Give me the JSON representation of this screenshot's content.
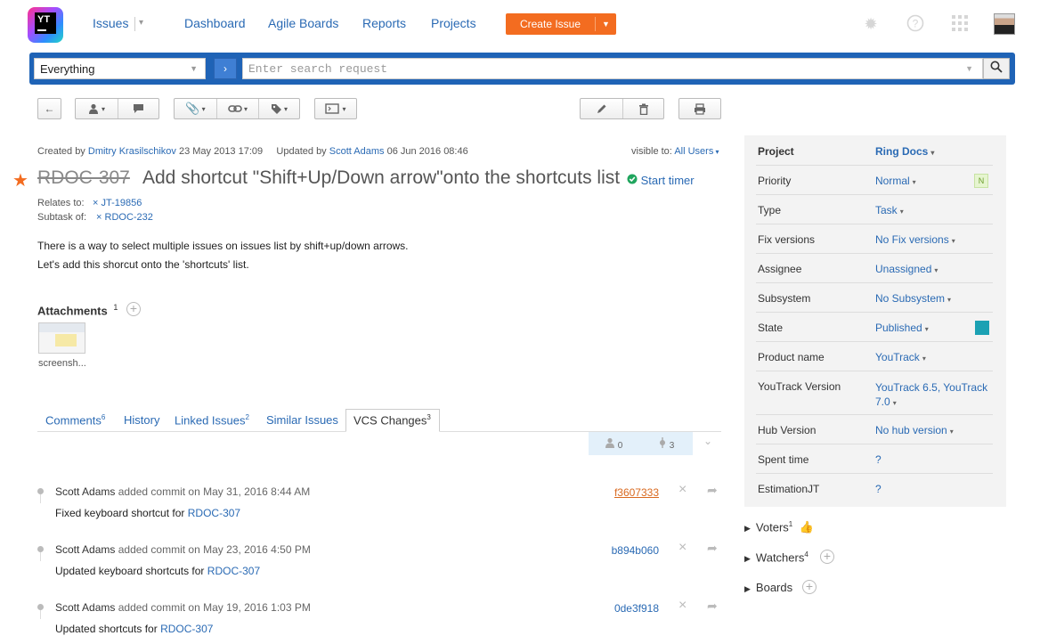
{
  "app": {
    "logo_text": "YT"
  },
  "nav": {
    "issues": "Issues",
    "dashboard": "Dashboard",
    "agile": "Agile Boards",
    "reports": "Reports",
    "projects": "Projects",
    "create": "Create Issue"
  },
  "search": {
    "context": "Everything",
    "placeholder": "Enter search request"
  },
  "meta": {
    "created_prefix": "Created by",
    "created_by": "Dmitry Krasilschikov",
    "created_at": "23 May 2013 17:09",
    "updated_prefix": "Updated by",
    "updated_by": "Scott Adams",
    "updated_at": "06 Jun 2016 08:46",
    "visible_label": "visible to:",
    "visible_value": "All Users"
  },
  "issue": {
    "id": "RDOC-307",
    "title": "Add shortcut \"Shift+Up/Down arrow\"onto the shortcuts list",
    "timer": "Start timer",
    "relates_label": "Relates to:",
    "relates_value": "JT-19856",
    "subtask_label": "Subtask of:",
    "subtask_value": "RDOC-232",
    "description_line1": "There is a way to select multiple issues on issues list by shift+up/down arrows.",
    "description_line2": "Let's add this shorcut onto the 'shortcuts' list."
  },
  "attachments": {
    "title": "Attachments",
    "count": "1",
    "file_label": "screensh..."
  },
  "tabs": {
    "comments": "Comments",
    "comments_count": "6",
    "history": "History",
    "linked": "Linked Issues",
    "linked_count": "2",
    "similar": "Similar Issues",
    "vcs": "VCS Changes",
    "vcs_count": "3"
  },
  "vcs_stats": {
    "users": "0",
    "commits": "3"
  },
  "commits": [
    {
      "author": "Scott Adams",
      "action": "added commit on",
      "date": "May 31, 2016 8:44 AM",
      "message": "Fixed keyboard shortcut for",
      "issue": "RDOC-307",
      "hash": "f3607333"
    },
    {
      "author": "Scott Adams",
      "action": "added commit on",
      "date": "May 23, 2016 4:50 PM",
      "message": "Updated keyboard shortcuts for",
      "issue": "RDOC-307",
      "hash": "b894b060"
    },
    {
      "author": "Scott Adams",
      "action": "added commit on",
      "date": "May 19, 2016 1:03 PM",
      "message": "Updated shortcuts for",
      "issue": "RDOC-307",
      "hash": "0de3f918"
    }
  ],
  "fields": {
    "project_label": "Project",
    "project_value": "Ring Docs",
    "priority_label": "Priority",
    "priority_value": "Normal",
    "priority_badge": "N",
    "type_label": "Type",
    "type_value": "Task",
    "fix_label": "Fix versions",
    "fix_value": "No Fix versions",
    "assignee_label": "Assignee",
    "assignee_value": "Unassigned",
    "subsystem_label": "Subsystem",
    "subsystem_value": "No Subsystem",
    "state_label": "State",
    "state_value": "Published",
    "product_label": "Product name",
    "product_value": "YouTrack",
    "ytversion_label": "YouTrack Version",
    "ytversion_value1": "YouTrack 6.5, YouTrack",
    "ytversion_value2": "7.0",
    "hub_label": "Hub Version",
    "hub_value": "No hub version",
    "spent_label": "Spent time",
    "spent_value": "?",
    "estimation_label": "EstimationJT",
    "estimation_value": "?"
  },
  "sidebar_sections": {
    "voters": "Voters",
    "voters_count": "1",
    "watchers": "Watchers",
    "watchers_count": "4",
    "boards": "Boards"
  },
  "colors": {
    "accent": "#2a6ab4",
    "create": "#f36c20",
    "state": "#1ba1b3",
    "searchbar": "#1f63b6"
  },
  "icons": [
    "back-icon",
    "user-icon",
    "comment-icon",
    "paperclip-icon",
    "link-icon",
    "tag-icon",
    "command-icon",
    "edit-icon",
    "delete-icon",
    "print-icon",
    "search-icon",
    "settings-icon",
    "help-icon",
    "apps-icon",
    "thumb-up-icon",
    "star-icon"
  ]
}
